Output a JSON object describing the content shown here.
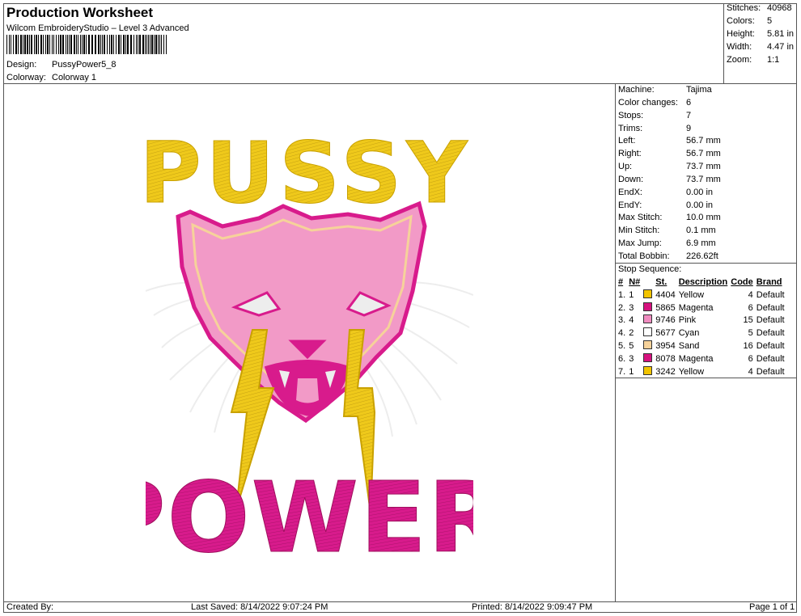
{
  "header": {
    "title": "Production Worksheet",
    "software": "Wilcom EmbroideryStudio – Level 3 Advanced",
    "design_label": "Design:",
    "design_value": "PussyPower5_8",
    "colorway_label": "Colorway:",
    "colorway_value": "Colorway 1"
  },
  "summary": [
    {
      "label": "Stitches:",
      "value": "40968"
    },
    {
      "label": "Colors:",
      "value": "5"
    },
    {
      "label": "Height:",
      "value": "5.81 in"
    },
    {
      "label": "Width:",
      "value": "4.47 in"
    },
    {
      "label": "Zoom:",
      "value": "1:1"
    }
  ],
  "machine": [
    {
      "label": "Machine:",
      "value": "Tajima"
    },
    {
      "label": "Color changes:",
      "value": "6"
    },
    {
      "label": "Stops:",
      "value": "7"
    },
    {
      "label": "Trims:",
      "value": "9"
    },
    {
      "label": "Left:",
      "value": "56.7 mm"
    },
    {
      "label": "Right:",
      "value": "56.7 mm"
    },
    {
      "label": "Up:",
      "value": "73.7 mm"
    },
    {
      "label": "Down:",
      "value": "73.7 mm"
    },
    {
      "label": "EndX:",
      "value": "0.00 in"
    },
    {
      "label": "EndY:",
      "value": "0.00 in"
    },
    {
      "label": "Max Stitch:",
      "value": "10.0 mm"
    },
    {
      "label": "Min Stitch:",
      "value": "0.1 mm"
    },
    {
      "label": "Max Jump:",
      "value": "6.9 mm"
    },
    {
      "label": "Total Bobbin:",
      "value": "226.62ft"
    }
  ],
  "stop_sequence": {
    "title": "Stop Sequence:",
    "headers": [
      "#",
      "N#",
      "St.",
      "Description",
      "Code",
      "Brand"
    ],
    "rows": [
      {
        "num": "1.",
        "n": "1",
        "color": "#F2C400",
        "st": "4404",
        "desc": "Yellow",
        "code": "4",
        "brand": "Default"
      },
      {
        "num": "2.",
        "n": "3",
        "color": "#D6127F",
        "st": "5865",
        "desc": "Magenta",
        "code": "6",
        "brand": "Default"
      },
      {
        "num": "3.",
        "n": "4",
        "color": "#F08CC0",
        "st": "9746",
        "desc": "Pink",
        "code": "15",
        "brand": "Default"
      },
      {
        "num": "4.",
        "n": "2",
        "color": "#FFFFFF",
        "st": "5677",
        "desc": "Cyan",
        "code": "5",
        "brand": "Default"
      },
      {
        "num": "5.",
        "n": "5",
        "color": "#F6D29A",
        "st": "3954",
        "desc": "Sand",
        "code": "16",
        "brand": "Default"
      },
      {
        "num": "6.",
        "n": "3",
        "color": "#D6127F",
        "st": "8078",
        "desc": "Magenta",
        "code": "6",
        "brand": "Default"
      },
      {
        "num": "7.",
        "n": "1",
        "color": "#F2C400",
        "st": "3242",
        "desc": "Yellow",
        "code": "4",
        "brand": "Default"
      }
    ]
  },
  "design_art": {
    "top_text": "PUSSY",
    "bottom_text": "POWER",
    "colors": {
      "yellow": "#EFC91B",
      "magenta": "#D81B8C",
      "pink": "#F29AC7",
      "sand": "#F6D29A",
      "white": "#EDEDED"
    }
  },
  "footer": {
    "created": "Created By:",
    "saved": "Last Saved: 8/14/2022 9:07:24 PM",
    "printed": "Printed: 8/14/2022 9:09:47 PM",
    "page": "Page 1 of 1"
  }
}
